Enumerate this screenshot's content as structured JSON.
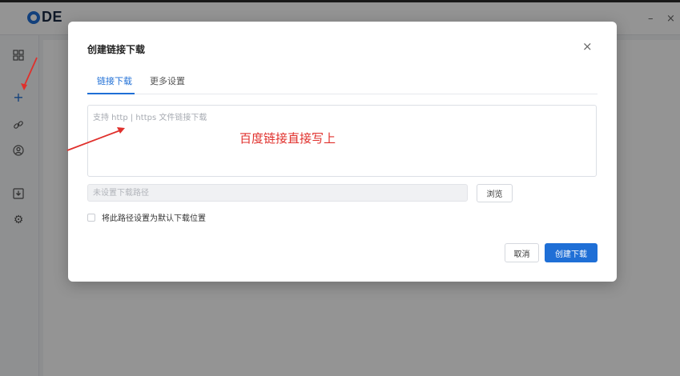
{
  "app": {
    "logo_text": "DE",
    "window_controls": {
      "minimize": "–",
      "close": "×"
    },
    "sidebar_items": [
      {
        "icon": "grid-icon",
        "glyph": "▦"
      },
      {
        "icon": "plus-icon",
        "glyph": "+"
      },
      {
        "icon": "link-icon",
        "glyph": "🔗"
      },
      {
        "icon": "user-icon",
        "glyph": "◉"
      },
      {
        "icon": "download-icon",
        "glyph": "⤓"
      },
      {
        "icon": "gear-icon",
        "glyph": "⚙"
      }
    ]
  },
  "dialog": {
    "title": "创建链接下载",
    "close_label": "×",
    "tabs": [
      {
        "label": "链接下载",
        "active": true
      },
      {
        "label": "更多设置",
        "active": false
      }
    ],
    "url_placeholder": "支持 http | https 文件链接下载",
    "path_placeholder": "未设置下载路径",
    "browse_label": "浏览",
    "default_path_label": "将此路径设置为默认下载位置",
    "cancel_label": "取消",
    "create_label": "创建下载"
  },
  "annotation": {
    "text": "百度链接直接写上",
    "color": "#e0302c"
  },
  "colors": {
    "accent": "#1f6fd6",
    "annotation_red": "#e0302c"
  }
}
